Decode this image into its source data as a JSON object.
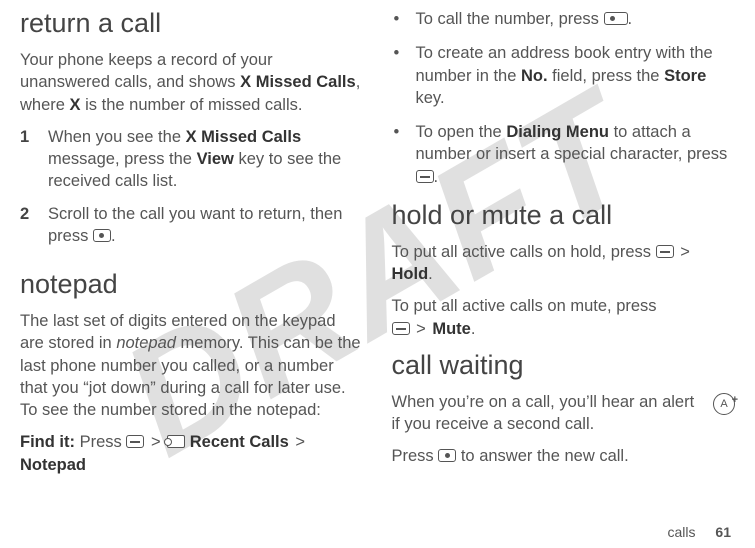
{
  "watermark": "DRAFT",
  "left": {
    "h_return": "return a call",
    "p_return_intro_a": "Your phone keeps a record of your unanswered calls, and shows ",
    "p_return_intro_b": "X Missed Calls",
    "p_return_intro_c": ", where ",
    "p_return_intro_d": "X",
    "p_return_intro_e": " is the number of missed calls.",
    "step1_num": "1",
    "step1_a": "When you see the ",
    "step1_b": "X Missed Calls",
    "step1_c": " message, press the ",
    "step1_d": "View",
    "step1_e": " key to see the received calls list.",
    "step2_num": "2",
    "step2_a": "Scroll to the call you want to return, then press ",
    "step2_b": ".",
    "h_notepad": "notepad",
    "p_notepad_a": "The last set of digits entered on the keypad are stored in ",
    "p_notepad_b": "notepad",
    "p_notepad_c": " memory. This can be the last phone number you called, or a number that you “jot down” during a call for later use. To see the number stored in the notepad:",
    "findit_label": "Find it:",
    "findit_a": " Press ",
    "findit_recent": "Recent Calls",
    "findit_notepad": "Notepad",
    "gt": ">"
  },
  "right": {
    "b1_a": "To call the number, press ",
    "b1_b": ".",
    "b2_a": "To create an address book entry with the number in the ",
    "b2_no": "No.",
    "b2_b": " field, press the ",
    "b2_store": "Store",
    "b2_c": " key.",
    "b3_a": "To open the ",
    "b3_menu": "Dialing Menu",
    "b3_b": " to attach a number or insert a special character, press ",
    "b3_c": ".",
    "h_hold": "hold or mute a call",
    "p_hold_a": "To put all active calls on hold, press ",
    "p_hold_hold": "Hold",
    "p_hold_b": ".",
    "p_mute_a": "To put all active calls on mute, press ",
    "p_mute_mute": "Mute",
    "p_mute_b": ".",
    "h_wait": "call waiting",
    "p_wait_a": "When you’re on a call, you’ll hear an alert if you receive a second call.",
    "p_wait_b_a": "Press ",
    "p_wait_b_b": " to answer the new call.",
    "feature_letter": "A",
    "gt": ">"
  },
  "footer": {
    "section": "calls",
    "page": "61"
  }
}
